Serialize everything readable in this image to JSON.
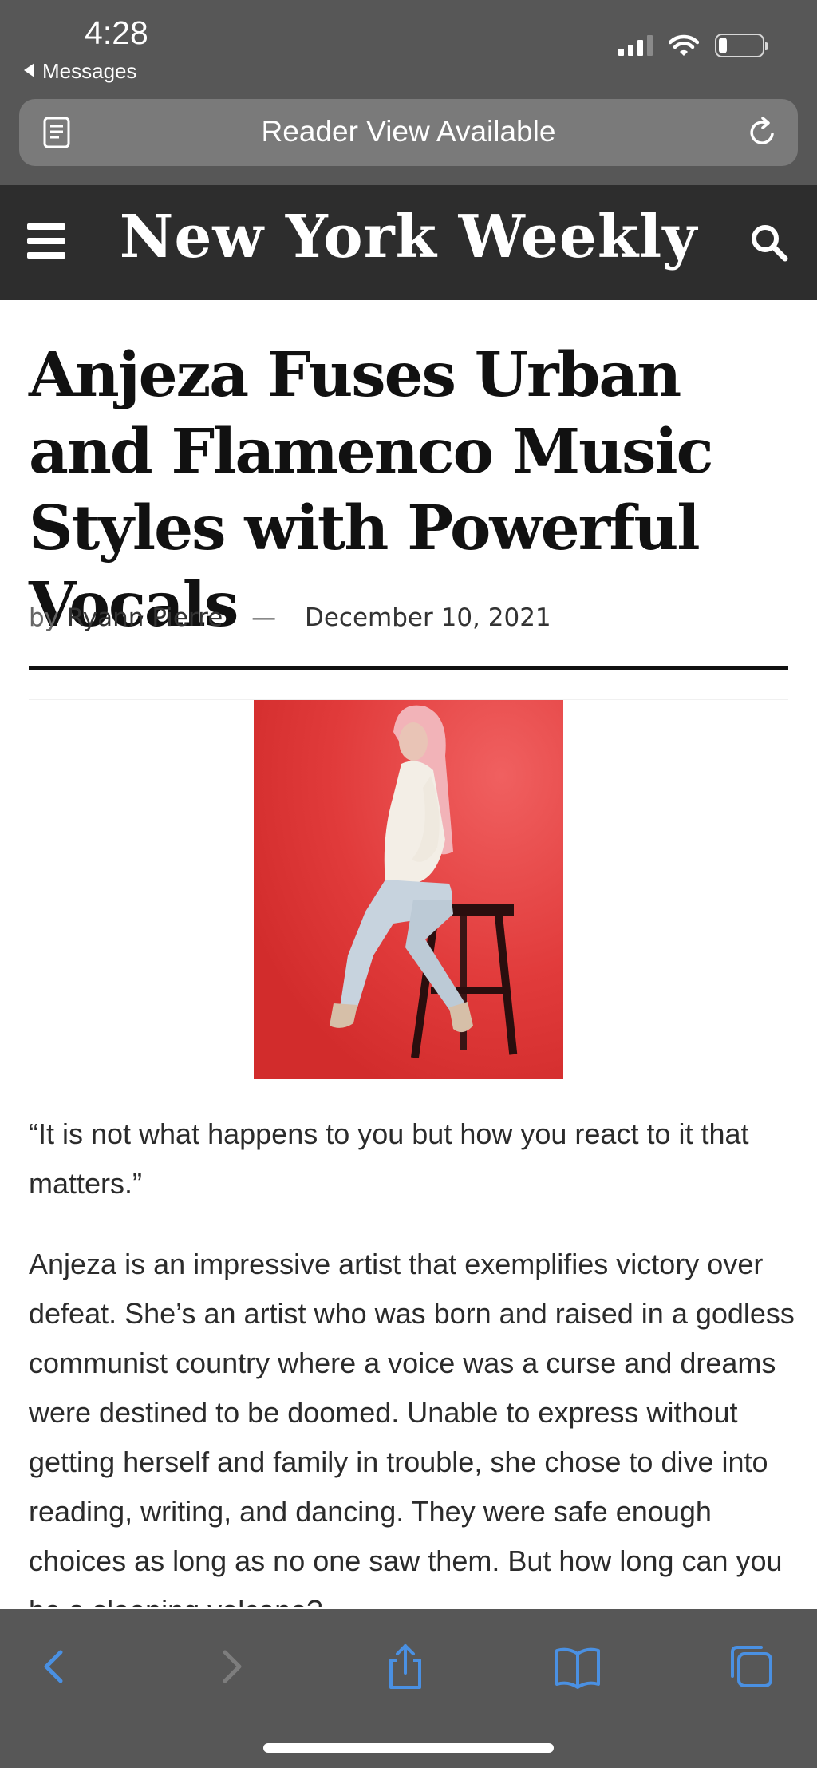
{
  "status_bar": {
    "time": "4:28",
    "back_app": "Messages",
    "battery_fraction": 0.2
  },
  "address_bar": {
    "text": "Reader View Available"
  },
  "site": {
    "logo": "New York Weekly"
  },
  "article": {
    "headline": "Anjeza Fuses Urban and Flamenco Music Styles with Powerful Vocals",
    "byline_prefix": "by",
    "author": "Ryann Pierre",
    "separator": "—",
    "date": "December 10, 2021",
    "quote": "“It is not what happens to you but how you react to it that matters.”",
    "paragraph": "Anjeza is an impressive artist that exemplifies victory over defeat. She’s an artist who was born and raised in a godless communist country where a voice was a curse and dreams were destined to be doomed. Unable to express without getting herself and family in trouble, she chose to dive into reading, writing, and dancing. They were safe enough choices as long as no one saw them. But how long can you be a sleeping volcano?"
  },
  "colors": {
    "chrome_bg": "#575757",
    "header_bg": "#2d2d2d",
    "toolbar_accent": "#4a90e2",
    "photo_bg": "#e03a3a"
  },
  "icons": {
    "reader": "reader-view-icon",
    "reload": "reload-icon",
    "menu": "hamburger-menu-icon",
    "search": "search-icon",
    "back": "chevron-left-icon",
    "forward": "chevron-right-icon",
    "share": "share-icon",
    "bookmarks": "book-icon",
    "tabs": "tabs-icon"
  }
}
